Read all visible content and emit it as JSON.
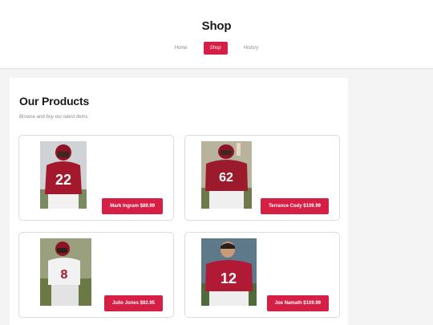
{
  "site": {
    "title": "Shop"
  },
  "nav": {
    "items": [
      {
        "label": "Home"
      },
      {
        "label": "Shop"
      },
      {
        "label": "History"
      }
    ]
  },
  "main": {
    "title": "Our Products",
    "subtitle": "Browse and buy our latest items",
    "products": [
      {
        "button_label": "Mark Ingram $89.99",
        "jersey_number": "22",
        "jersey_color": "#a3182c"
      },
      {
        "button_label": "Terrance Cody $109.99",
        "jersey_number": "62",
        "jersey_color": "#9b1a2c"
      },
      {
        "button_label": "Julio Jones $92.95",
        "jersey_number": "8",
        "jersey_color": "#f2f2f2"
      },
      {
        "button_label": "Joe Namath $109.99",
        "jersey_number": "12",
        "jersey_color": "#b01a35"
      }
    ]
  },
  "colors": {
    "accent": "#d61f45",
    "page_bg": "#f4f4f4",
    "panel_bg": "#ffffff"
  }
}
